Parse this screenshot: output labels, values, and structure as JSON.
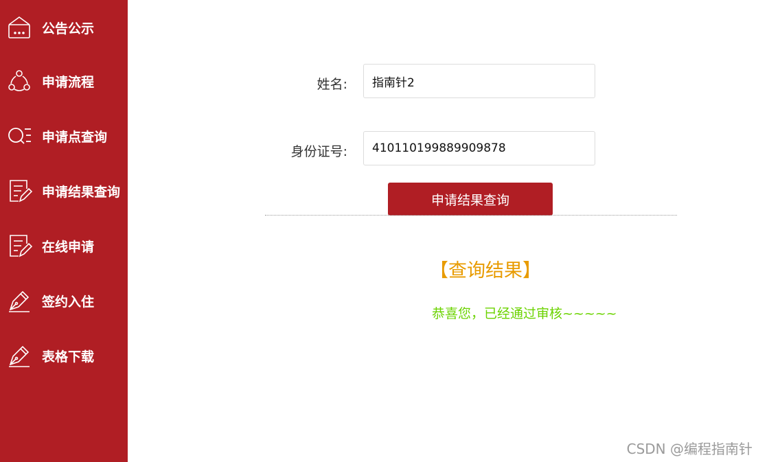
{
  "sidebar": {
    "items": [
      {
        "label": "公告公示",
        "icon": "announcement-icon"
      },
      {
        "label": "申请流程",
        "icon": "process-icon"
      },
      {
        "label": "申请点查询",
        "icon": "search-list-icon"
      },
      {
        "label": "申请结果查询",
        "icon": "document-edit-icon"
      },
      {
        "label": "在线申请",
        "icon": "document-edit-icon"
      },
      {
        "label": "签约入住",
        "icon": "sign-pen-icon"
      },
      {
        "label": "表格下载",
        "icon": "sign-pen-icon"
      }
    ]
  },
  "form": {
    "name_label": "姓名:",
    "name_value": "指南针2",
    "id_label": "身份证号:",
    "id_value": "410110199889909878",
    "submit_label": "申请结果查询"
  },
  "result": {
    "title": "【查询结果】",
    "message": "恭喜您，已经通过审核~~~~~"
  },
  "watermark": "CSDN @编程指南针",
  "colors": {
    "sidebar_bg": "#b01e24",
    "button_bg": "#b01e24",
    "result_title": "#e89b00",
    "result_message": "#6bd300"
  }
}
